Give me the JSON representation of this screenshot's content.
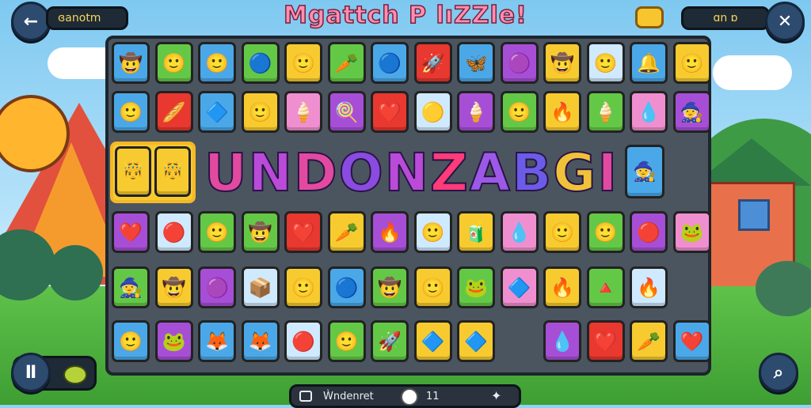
{
  "header": {
    "title": "Mgattch P lıZZle!",
    "left_counter": "ɞanotm",
    "right_counter": "ɑn ɒ",
    "back_icon": "arrow-left-icon",
    "close_icon": "close-icon",
    "coins_icon": "coin-stack-icon"
  },
  "banner": {
    "letters": [
      "U",
      "N",
      "D",
      "O",
      "N",
      "Z",
      "A",
      "B",
      "G",
      "I"
    ],
    "colors": [
      "#e24aa0",
      "#b94bd8",
      "#e24aa0",
      "#8a4be0",
      "#b94bd8",
      "#ff3b7a",
      "#9c59e8",
      "#6b5ce8",
      "#f0c23a",
      "#e24aa0"
    ]
  },
  "colors": {
    "blue": "#4aa8e8",
    "green": "#64c847",
    "yellow": "#f7cb2f",
    "red": "#e8382f",
    "purple": "#a64fd6",
    "pink": "#f08fd0",
    "cyan": "#cfeaff",
    "orange": "#f39c2a"
  },
  "rows": [
    [
      "blue:🤠",
      "green:🙂",
      "blue:🙂",
      "green:🔵",
      "yellow:🙂",
      "green:🥕",
      "blue:🔵",
      "red:🚀",
      "blue:🦋",
      "purple:🟣",
      "yellow:🤠",
      "cyan:🙂",
      "blue:🔔",
      "yellow:🙂"
    ],
    [
      "blue:🙂",
      "red:🥖",
      "blue:🔷",
      "yellow:🙂",
      "pink:🍦",
      "purple:🍭",
      "red:❤️",
      "cyan:🟡",
      "purple:🍦",
      "green:🙂",
      "yellow:🔥",
      "green:🍦",
      "pink:💧",
      "purple:🧙"
    ],
    [
      "purple:❤️",
      "cyan:🔴",
      "green:🙂",
      "green:🤠",
      "red:❤️",
      "yellow:🥕",
      "purple:🔥",
      "cyan:🙂",
      "yellow:🧃",
      "pink:💧",
      "yellow:🙂",
      "green:🙂",
      "purple:🔴",
      "pink:🐸"
    ],
    [
      "green:🧙",
      "yellow:🤠",
      "purple:🟣",
      "cyan:📦",
      "yellow:🙂",
      "blue:🔵",
      "green:🤠",
      "yellow:🙂",
      "green:🐸",
      "pink:🔷",
      "yellow:🔥",
      "green:🔺",
      "cyan:🔥"
    ],
    [
      "blue:🙂",
      "purple:🐸",
      "blue:🦊",
      "blue:🦊",
      "cyan:🔴",
      "green:🙂",
      "green:🚀",
      "yellow:🔷",
      "yellow:🔷",
      "",
      "purple:💧",
      "red:❤️",
      "yellow:🥕",
      "blue:❤️"
    ]
  ],
  "kings": [
    "yellow:🤴",
    "yellow:🤴"
  ],
  "king_right": "blue:🧙",
  "bottom": {
    "label": "Ẁndenret",
    "count": "11",
    "plus_icon": "plus-icon",
    "info_icon": "frame-icon"
  },
  "pause_icon": "pause-icon",
  "hint_icon": "magnifier-icon"
}
